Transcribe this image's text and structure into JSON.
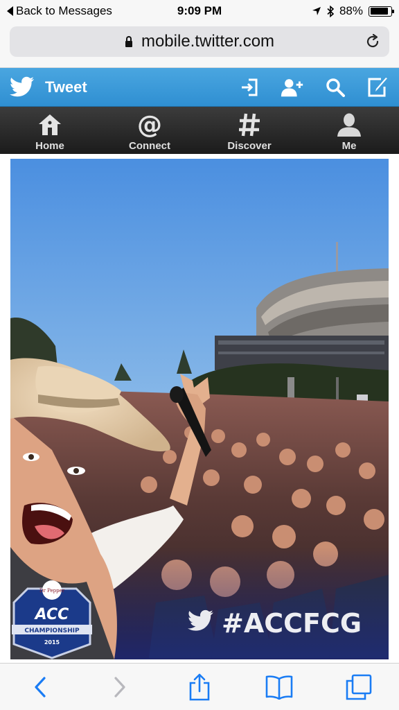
{
  "status_bar": {
    "back_label": "Back to Messages",
    "time": "9:09 PM",
    "battery_percent": "88%",
    "battery_level": 0.88,
    "icons": [
      "location-arrow-icon",
      "bluetooth-icon",
      "battery-icon"
    ]
  },
  "browser": {
    "url": "mobile.twitter.com"
  },
  "twitter": {
    "title": "Tweet",
    "brand_color": "#3d9ad9",
    "header_icons": [
      "sign-in-icon",
      "add-user-icon",
      "search-icon",
      "compose-icon"
    ],
    "nav": [
      {
        "label": "Home",
        "icon": "house-icon"
      },
      {
        "label": "Connect",
        "icon": "at-sign-icon"
      },
      {
        "label": "Discover",
        "icon": "hashtag-icon"
      },
      {
        "label": "Me",
        "icon": "person-icon"
      }
    ]
  },
  "photo": {
    "hashtag": "#ACCFCG",
    "badge": {
      "sponsor": "Dr Pepper",
      "acc": "ACC",
      "championship": "CHAMPIONSHIP",
      "year": "2015"
    }
  },
  "toolbar": {
    "icons": [
      "back-icon",
      "forward-icon",
      "share-icon",
      "bookmarks-icon",
      "tabs-icon"
    ]
  }
}
